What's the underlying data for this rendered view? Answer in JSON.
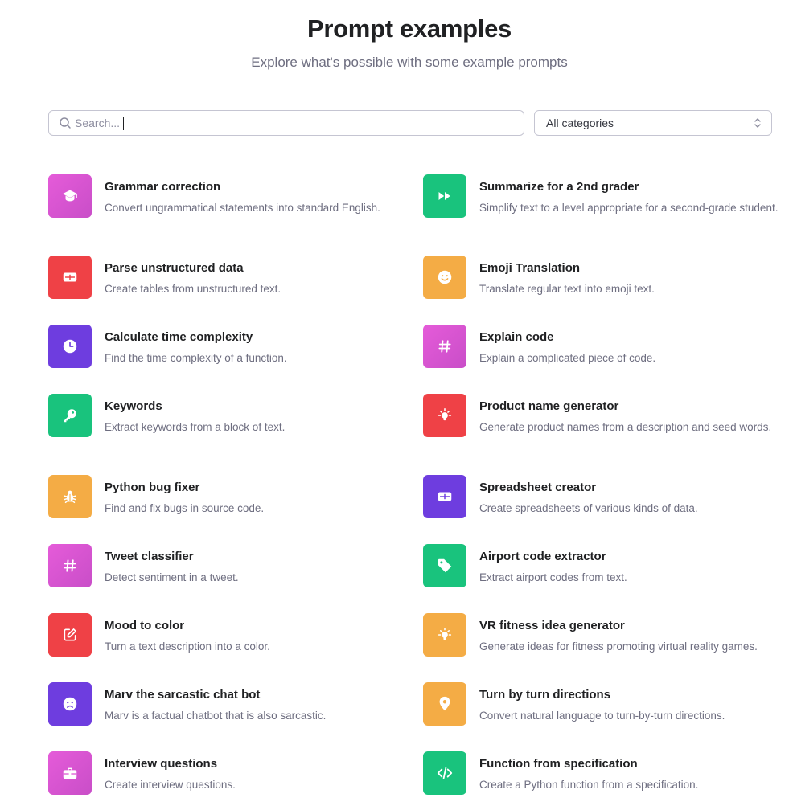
{
  "header": {
    "title": "Prompt examples",
    "subtitle": "Explore what's possible with some example prompts"
  },
  "search": {
    "placeholder": "Search...",
    "icon": "search-icon"
  },
  "category_select": {
    "selected": "All categories",
    "icon": "chevron-updown-icon"
  },
  "colors": {
    "pink": "#dd55d3",
    "green": "#19c37d",
    "red": "#ef4146",
    "orange": "#f4ac45",
    "purple": "#6e3ddf"
  },
  "examples": [
    {
      "title": "Grammar correction",
      "description": "Convert ungrammatical statements into standard English.",
      "icon": "graduation-cap-icon",
      "color": "pink"
    },
    {
      "title": "Summarize for a 2nd grader",
      "description": "Simplify text to a level appropriate for a second-grade student.",
      "icon": "fast-forward-icon",
      "color": "green"
    },
    {
      "title": "Parse unstructured data",
      "description": "Create tables from unstructured text.",
      "icon": "table-icon",
      "color": "red"
    },
    {
      "title": "Emoji Translation",
      "description": "Translate regular text into emoji text.",
      "icon": "smiley-icon",
      "color": "orange"
    },
    {
      "title": "Calculate time complexity",
      "description": "Find the time complexity of a function.",
      "icon": "clock-icon",
      "color": "purple"
    },
    {
      "title": "Explain code",
      "description": "Explain a complicated piece of code.",
      "icon": "hashtag-icon",
      "color": "pink"
    },
    {
      "title": "Keywords",
      "description": "Extract keywords from a block of text.",
      "icon": "key-icon",
      "color": "green"
    },
    {
      "title": "Product name generator",
      "description": "Generate product names from a description and seed words.",
      "icon": "lightbulb-icon",
      "color": "red"
    },
    {
      "title": "Python bug fixer",
      "description": "Find and fix bugs in source code.",
      "icon": "bug-icon",
      "color": "orange"
    },
    {
      "title": "Spreadsheet creator",
      "description": "Create spreadsheets of various kinds of data.",
      "icon": "table-icon",
      "color": "purple"
    },
    {
      "title": "Tweet classifier",
      "description": "Detect sentiment in a tweet.",
      "icon": "hashtag-icon",
      "color": "pink"
    },
    {
      "title": "Airport code extractor",
      "description": "Extract airport codes from text.",
      "icon": "tag-icon",
      "color": "green"
    },
    {
      "title": "Mood to color",
      "description": "Turn a text description into a color.",
      "icon": "edit-icon",
      "color": "red"
    },
    {
      "title": "VR fitness idea generator",
      "description": "Generate ideas for fitness promoting virtual reality games.",
      "icon": "lightbulb-icon",
      "color": "orange"
    },
    {
      "title": "Marv the sarcastic chat bot",
      "description": "Marv is a factual chatbot that is also sarcastic.",
      "icon": "sad-face-icon",
      "color": "purple"
    },
    {
      "title": "Turn by turn directions",
      "description": "Convert natural language to turn-by-turn directions.",
      "icon": "map-pin-icon",
      "color": "orange"
    },
    {
      "title": "Interview questions",
      "description": "Create interview questions.",
      "icon": "briefcase-icon",
      "color": "pink"
    },
    {
      "title": "Function from specification",
      "description": "Create a Python function from a specification.",
      "icon": "code-icon",
      "color": "green"
    }
  ]
}
